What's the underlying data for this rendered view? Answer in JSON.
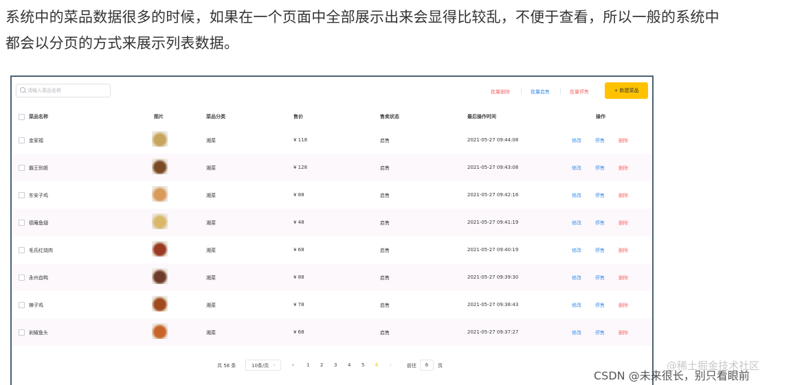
{
  "intro": {
    "line1": "系统中的菜品数据很多的时候，如果在一个页面中全部展示出来会显得比较乱，不便于查看，所以一般的系统中",
    "line2": "都会以分页的方式来展示列表数据。"
  },
  "toolbar": {
    "search_placeholder": "请输入菜品名称",
    "batch_delete": "批量删除",
    "batch_on": "批量启售",
    "batch_off": "批量停售",
    "new_dish": "+ 新建菜品"
  },
  "table": {
    "headers": [
      "菜品名称",
      "图片",
      "菜品分类",
      "售价",
      "售卖状态",
      "最后操作时间",
      "操作"
    ],
    "rows": [
      {
        "name": "金家福",
        "category": "湘菜",
        "price": "¥ 118",
        "status": "启售",
        "time": "2021-05-27 09:44:08",
        "edit": "修改",
        "toggle": "停售",
        "delete": "删除",
        "img": "#c7a55a"
      },
      {
        "name": "霸王别姬",
        "category": "湘菜",
        "price": "¥ 128",
        "status": "启售",
        "time": "2021-05-27 09:43:08",
        "edit": "修改",
        "toggle": "停售",
        "delete": "删除",
        "img": "#7a4a26"
      },
      {
        "name": "东安子鸡",
        "category": "湘菜",
        "price": "¥ 88",
        "status": "启售",
        "time": "2021-05-27 09:42:16",
        "edit": "修改",
        "toggle": "停售",
        "delete": "删除",
        "img": "#d99a5a"
      },
      {
        "name": "德庵鱼翅",
        "category": "湘菜",
        "price": "¥ 48",
        "status": "启售",
        "time": "2021-05-27 09:41:19",
        "edit": "修改",
        "toggle": "停售",
        "delete": "删除",
        "img": "#d9b86a"
      },
      {
        "name": "毛氏红烧肉",
        "category": "湘菜",
        "price": "¥ 68",
        "status": "启售",
        "time": "2021-05-27 09:40:19",
        "edit": "修改",
        "toggle": "停售",
        "delete": "删除",
        "img": "#9a3a22"
      },
      {
        "name": "永州血鸭",
        "category": "湘菜",
        "price": "¥ 88",
        "status": "启售",
        "time": "2021-05-27 09:39:30",
        "edit": "修改",
        "toggle": "停售",
        "delete": "删除",
        "img": "#6e3a2a"
      },
      {
        "name": "辣子鸡",
        "category": "湘菜",
        "price": "¥ 78",
        "status": "启售",
        "time": "2021-05-27 09:38:43",
        "edit": "修改",
        "toggle": "停售",
        "delete": "删除",
        "img": "#a04a1e"
      },
      {
        "name": "剁椒鱼头",
        "category": "湘菜",
        "price": "¥ 68",
        "status": "启售",
        "time": "2021-05-27 09:37:27",
        "edit": "修改",
        "toggle": "停售",
        "delete": "删除",
        "img": "#c8642a"
      }
    ]
  },
  "pagination": {
    "total": "共 58 条",
    "page_size": "10条/页",
    "prev": "‹",
    "next": "›",
    "pages": [
      "1",
      "2",
      "3",
      "4",
      "5",
      "6"
    ],
    "current_page": "6",
    "goto_label": "前往",
    "goto_value": "6",
    "page_suffix": "页"
  },
  "watermark": {
    "site": "@稀土掘金技术社区",
    "author": "CSDN @未来很长，别只看眼前"
  }
}
